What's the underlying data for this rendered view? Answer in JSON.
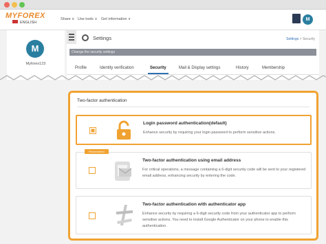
{
  "header": {
    "logo": "MYFOREX",
    "language": "ENGLISH",
    "nav": [
      "Share ∨",
      "Use tools ∨",
      "Get information ∨"
    ],
    "avatar": "M"
  },
  "sidebar": {
    "avatar": "M",
    "username": "Myforex123"
  },
  "page": {
    "title": "Settings",
    "breadcrumb_root": "Settings",
    "breadcrumb_sep": ">",
    "breadcrumb_current": "Security",
    "description": "Change the security settings",
    "tabs": [
      "Profile",
      "Identity verification",
      "Security",
      "Mail & Display settings",
      "History",
      "Membership"
    ],
    "active_tab": "Security"
  },
  "security": {
    "section_title": "Two-factor authentication",
    "options": [
      {
        "title": "Login password authentication(default)",
        "desc": "Enhance security by requiring your login password to perform sensitive actions.",
        "checked": true,
        "icon": "padlock-icon"
      },
      {
        "badge": "Recommend",
        "title": "Two-factor authentication using email address",
        "desc": "For critical operations, a message containing a 6-digit security code will be sent to your registered email address, enhancing security by entering the code.",
        "checked": false,
        "icon": "email-device-icon"
      },
      {
        "title": "Two-factor authentication with authenticator app",
        "desc": "Enhance security by requiring a 6-digit security code from your authenticator app to perform sensitive actions. You need to install Google Authenticator on your phone to enable this authentication.",
        "checked": false,
        "icon": "authenticator-icon"
      }
    ]
  },
  "colors": {
    "accent": "#f0a231",
    "brand": "#e8892b",
    "link": "#2f6fb2",
    "avatar": "#2a7fa0"
  }
}
